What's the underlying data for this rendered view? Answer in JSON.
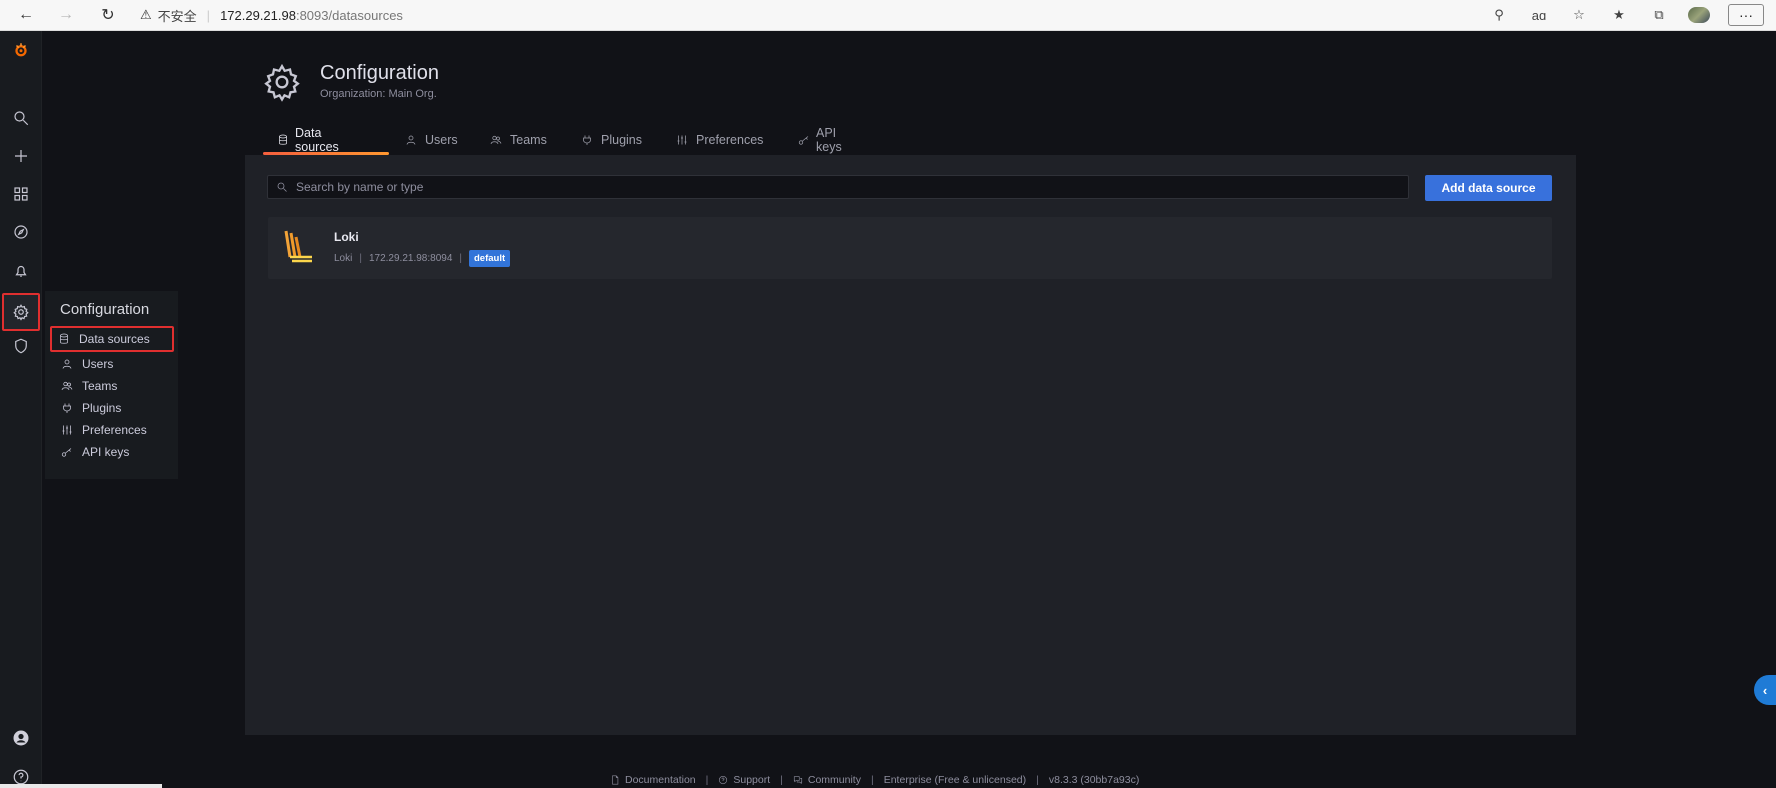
{
  "browser": {
    "security_label": "不安全",
    "url_host": "172.29.21.98",
    "url_path": ":8093/datasources",
    "more_label": "···"
  },
  "flyout": {
    "title": "Configuration",
    "items": [
      {
        "label": "Data sources",
        "icon": "database-icon"
      },
      {
        "label": "Users",
        "icon": "user-icon"
      },
      {
        "label": "Teams",
        "icon": "users-icon"
      },
      {
        "label": "Plugins",
        "icon": "plug-icon"
      },
      {
        "label": "Preferences",
        "icon": "sliders-icon"
      },
      {
        "label": "API keys",
        "icon": "key-icon"
      }
    ]
  },
  "header": {
    "title": "Configuration",
    "subtitle": "Organization: Main Org."
  },
  "tabs": [
    {
      "label": "Data sources",
      "active": true
    },
    {
      "label": "Users",
      "active": false
    },
    {
      "label": "Teams",
      "active": false
    },
    {
      "label": "Plugins",
      "active": false
    },
    {
      "label": "Preferences",
      "active": false
    },
    {
      "label": "API keys",
      "active": false
    }
  ],
  "search": {
    "placeholder": "Search by name or type"
  },
  "add_button_label": "Add data source",
  "datasources": [
    {
      "name": "Loki",
      "type": "Loki",
      "url": "172.29.21.98:8094",
      "badge": "default"
    }
  ],
  "footer": {
    "documentation": "Documentation",
    "support": "Support",
    "community": "Community",
    "edition": "Enterprise (Free & unlicensed)",
    "version": "v8.3.3 (30bb7a93c)"
  },
  "colors": {
    "accent": "#3871dc",
    "tab_underline": "#f55f3e",
    "highlight": "#e02f2f",
    "background": "#111217"
  }
}
